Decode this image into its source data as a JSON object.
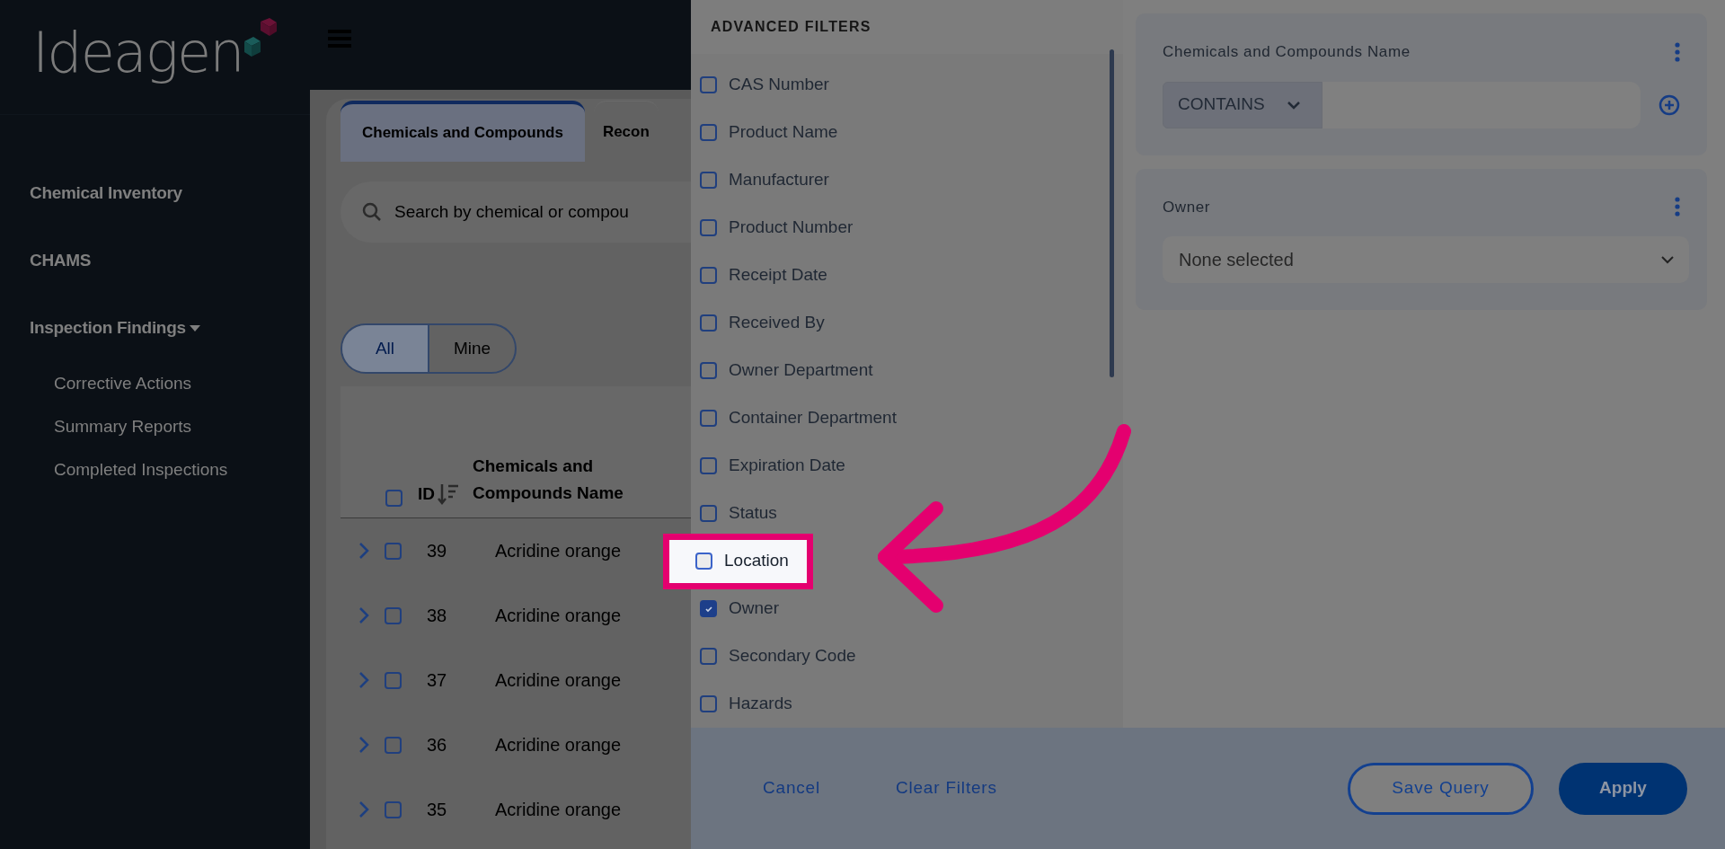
{
  "sidebar": {
    "logo": "Ideagen",
    "items": [
      {
        "label": "Chemical Inventory"
      },
      {
        "label": "CHAMS"
      },
      {
        "label": "Inspection Findings",
        "expanded": true,
        "children": [
          {
            "label": "Corrective Actions"
          },
          {
            "label": "Summary Reports"
          },
          {
            "label": "Completed Inspections"
          }
        ]
      }
    ]
  },
  "tabs": [
    {
      "label": "Chemicals and Compounds",
      "selected": true
    },
    {
      "label": "Recon",
      "selected": false
    }
  ],
  "search": {
    "placeholder": "Search by chemical or compou"
  },
  "scope_toggle": [
    {
      "label": "All",
      "selected": true
    },
    {
      "label": "Mine",
      "selected": false
    }
  ],
  "table": {
    "columns": [
      "ID",
      "Chemicals and Compounds Name"
    ],
    "all_checked": false,
    "rows": [
      {
        "id": "39",
        "name": "Acridine orange",
        "checked": false
      },
      {
        "id": "38",
        "name": "Acridine orange",
        "checked": false
      },
      {
        "id": "37",
        "name": "Acridine orange",
        "checked": false
      },
      {
        "id": "36",
        "name": "Acridine orange",
        "checked": false
      },
      {
        "id": "35",
        "name": "Acridine orange",
        "checked": false
      }
    ]
  },
  "advanced_filters": {
    "title": "ADVANCED FILTERS",
    "items": [
      {
        "label": "CAS Number",
        "checked": false,
        "highlighted": false
      },
      {
        "label": "Product Name",
        "checked": false,
        "highlighted": false
      },
      {
        "label": "Manufacturer",
        "checked": false,
        "highlighted": false
      },
      {
        "label": "Product Number",
        "checked": false,
        "highlighted": false
      },
      {
        "label": "Receipt Date",
        "checked": false,
        "highlighted": false
      },
      {
        "label": "Received By",
        "checked": false,
        "highlighted": false
      },
      {
        "label": "Owner Department",
        "checked": false,
        "highlighted": false
      },
      {
        "label": "Container Department",
        "checked": false,
        "highlighted": false
      },
      {
        "label": "Expiration Date",
        "checked": false,
        "highlighted": false
      },
      {
        "label": "Status",
        "checked": false,
        "highlighted": false
      },
      {
        "label": "Location",
        "checked": false,
        "highlighted": true
      },
      {
        "label": "Owner",
        "checked": true,
        "highlighted": false
      },
      {
        "label": "Secondary Code",
        "checked": false,
        "highlighted": false
      },
      {
        "label": "Hazards",
        "checked": false,
        "highlighted": false
      }
    ]
  },
  "filters": [
    {
      "kind": "text",
      "label": "Chemicals and Compounds Name",
      "operator": "CONTAINS"
    },
    {
      "kind": "select",
      "label": "Owner",
      "value": "None selected"
    }
  ],
  "footer": {
    "buttons": [
      {
        "kind": "link",
        "label": "Cancel"
      },
      {
        "kind": "link",
        "label": "Clear Filters"
      },
      {
        "kind": "outline",
        "label": "Save Query"
      },
      {
        "kind": "primary",
        "label": "Apply"
      }
    ]
  }
}
